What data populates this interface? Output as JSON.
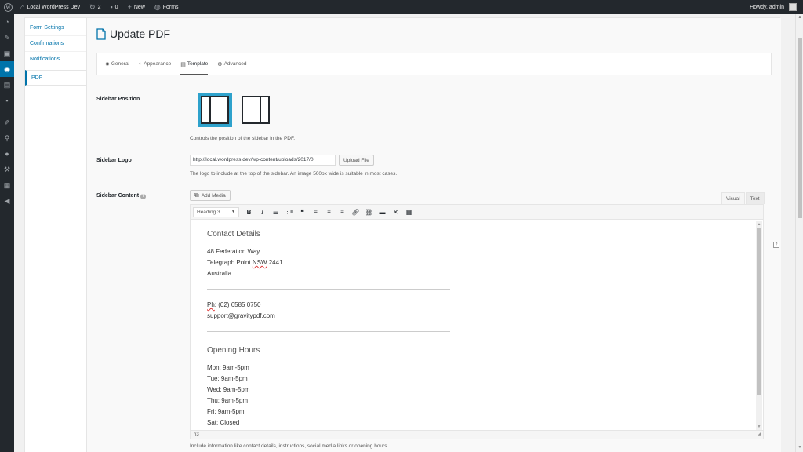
{
  "adminbar": {
    "site_name": "Local WordPress Dev",
    "updates_count": "2",
    "comments_count": "0",
    "new_label": "New",
    "forms_label": "Forms",
    "greeting": "Howdy, admin"
  },
  "subnav": {
    "items": [
      "Form Settings",
      "Confirmations",
      "Notifications",
      "PDF"
    ]
  },
  "page": {
    "title": "Update PDF"
  },
  "tabs": [
    {
      "label": "General",
      "icon": "gear-icon"
    },
    {
      "label": "Appearance",
      "icon": "contrast-icon"
    },
    {
      "label": "Template",
      "icon": "document-icon"
    },
    {
      "label": "Advanced",
      "icon": "cogs-icon"
    }
  ],
  "active_tab": "Template",
  "sidebar_position": {
    "label": "Sidebar Position",
    "description": "Controls the position of the sidebar in the PDF.",
    "options": [
      "left",
      "right"
    ],
    "selected": "left"
  },
  "sidebar_logo": {
    "label": "Sidebar Logo",
    "value": "http://local.wordpress.dev/wp-content/uploads/2017/0",
    "upload_label": "Upload File",
    "description": "The logo to include at the top of the sidebar. An image 500px wide is suitable in most cases."
  },
  "sidebar_content": {
    "label": "Sidebar Content",
    "add_media_label": "Add Media",
    "tab_visual": "Visual",
    "tab_text": "Text",
    "format_selected": "Heading 3",
    "toolbar_buttons": [
      "bold",
      "italic",
      "bullet-list",
      "numbered-list",
      "blockquote",
      "align-left",
      "align-center",
      "align-right",
      "link",
      "unlink",
      "read-more",
      "fullscreen",
      "toolbar-toggle"
    ],
    "heading1": "Contact Details",
    "address_lines": [
      "48 Federation Way",
      "Telegraph Point NSW 2441",
      "Australia"
    ],
    "phone": "Ph: (02) 6585 0750",
    "email": "support@gravitypdf.com",
    "heading2": "Opening Hours",
    "hours": [
      "Mon: 9am-5pm",
      "Tue: 9am-5pm",
      "Wed: 9am-5pm",
      "Thu: 9am-5pm",
      "Fri: 9am-5pm",
      "Sat: Closed"
    ],
    "status_path": "h3",
    "description": "Include information like contact details, instructions, social media links or opening hours."
  }
}
